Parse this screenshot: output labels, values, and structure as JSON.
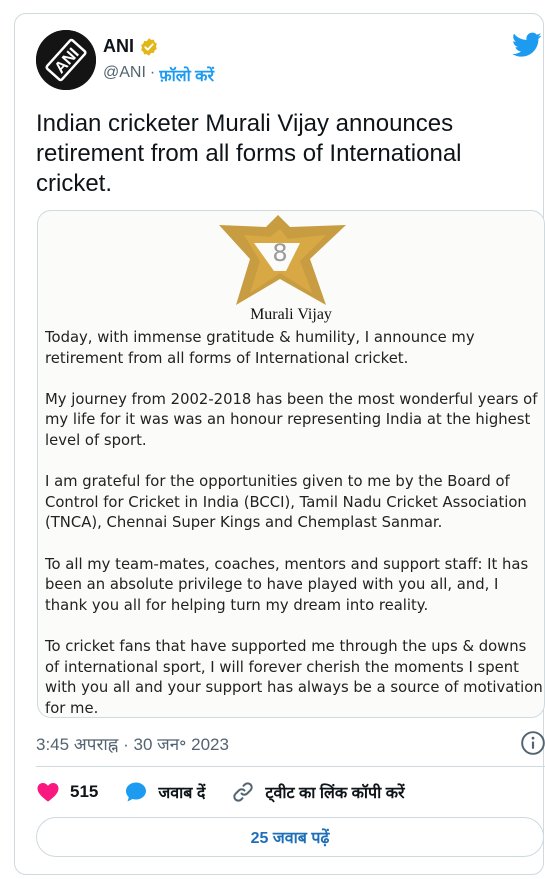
{
  "author": {
    "name": "ANI",
    "handle": "@ANI",
    "separator": "·",
    "follow_label": "फ़ॉलो करें",
    "avatar_text": "ANI"
  },
  "tweet": {
    "text": "Indian cricketer Murali Vijay announces retirement from all forms of International cricket."
  },
  "media": {
    "logo_name": "Murali Vijay",
    "logo_numeral": "8",
    "paragraphs": [
      "Today, with immense gratitude & humility, I announce my retirement from all forms of International cricket.",
      "My journey from 2002-2018 has been the most wonderful years of my life for it was was an honour representing India at the highest level of sport.",
      "I am grateful for the opportunities given to me by the Board of Control for Cricket in India (BCCI), Tamil Nadu Cricket Association (TNCA), Chennai Super Kings and Chemplast Sanmar.",
      "To all my team-mates, coaches, mentors and support staff: It has been an absolute privilege to have played with you all, and, I thank you all for helping turn my dream into reality.",
      "To cricket fans that have supported me through the ups & downs of international sport, I will forever cherish the moments I spent with you all and your support has always be a source of motivation for me."
    ]
  },
  "meta": {
    "timestamp": "3:45 अपराह्न · 30 जन॰ 2023"
  },
  "actions": {
    "like_count": "515",
    "reply_label": "जवाब दें",
    "copy_link_label": "ट्वीट का लिंक कॉपी करें"
  },
  "replies_button": {
    "label": "25 जवाब पढ़ें"
  },
  "colors": {
    "accent": "#1d9bf0",
    "like": "#f91880",
    "verified": "#e2b719",
    "star": "#c59838"
  },
  "icons": [
    "verified-badge-icon",
    "twitter-bird-icon",
    "info-icon",
    "heart-icon",
    "reply-icon",
    "link-icon"
  ]
}
